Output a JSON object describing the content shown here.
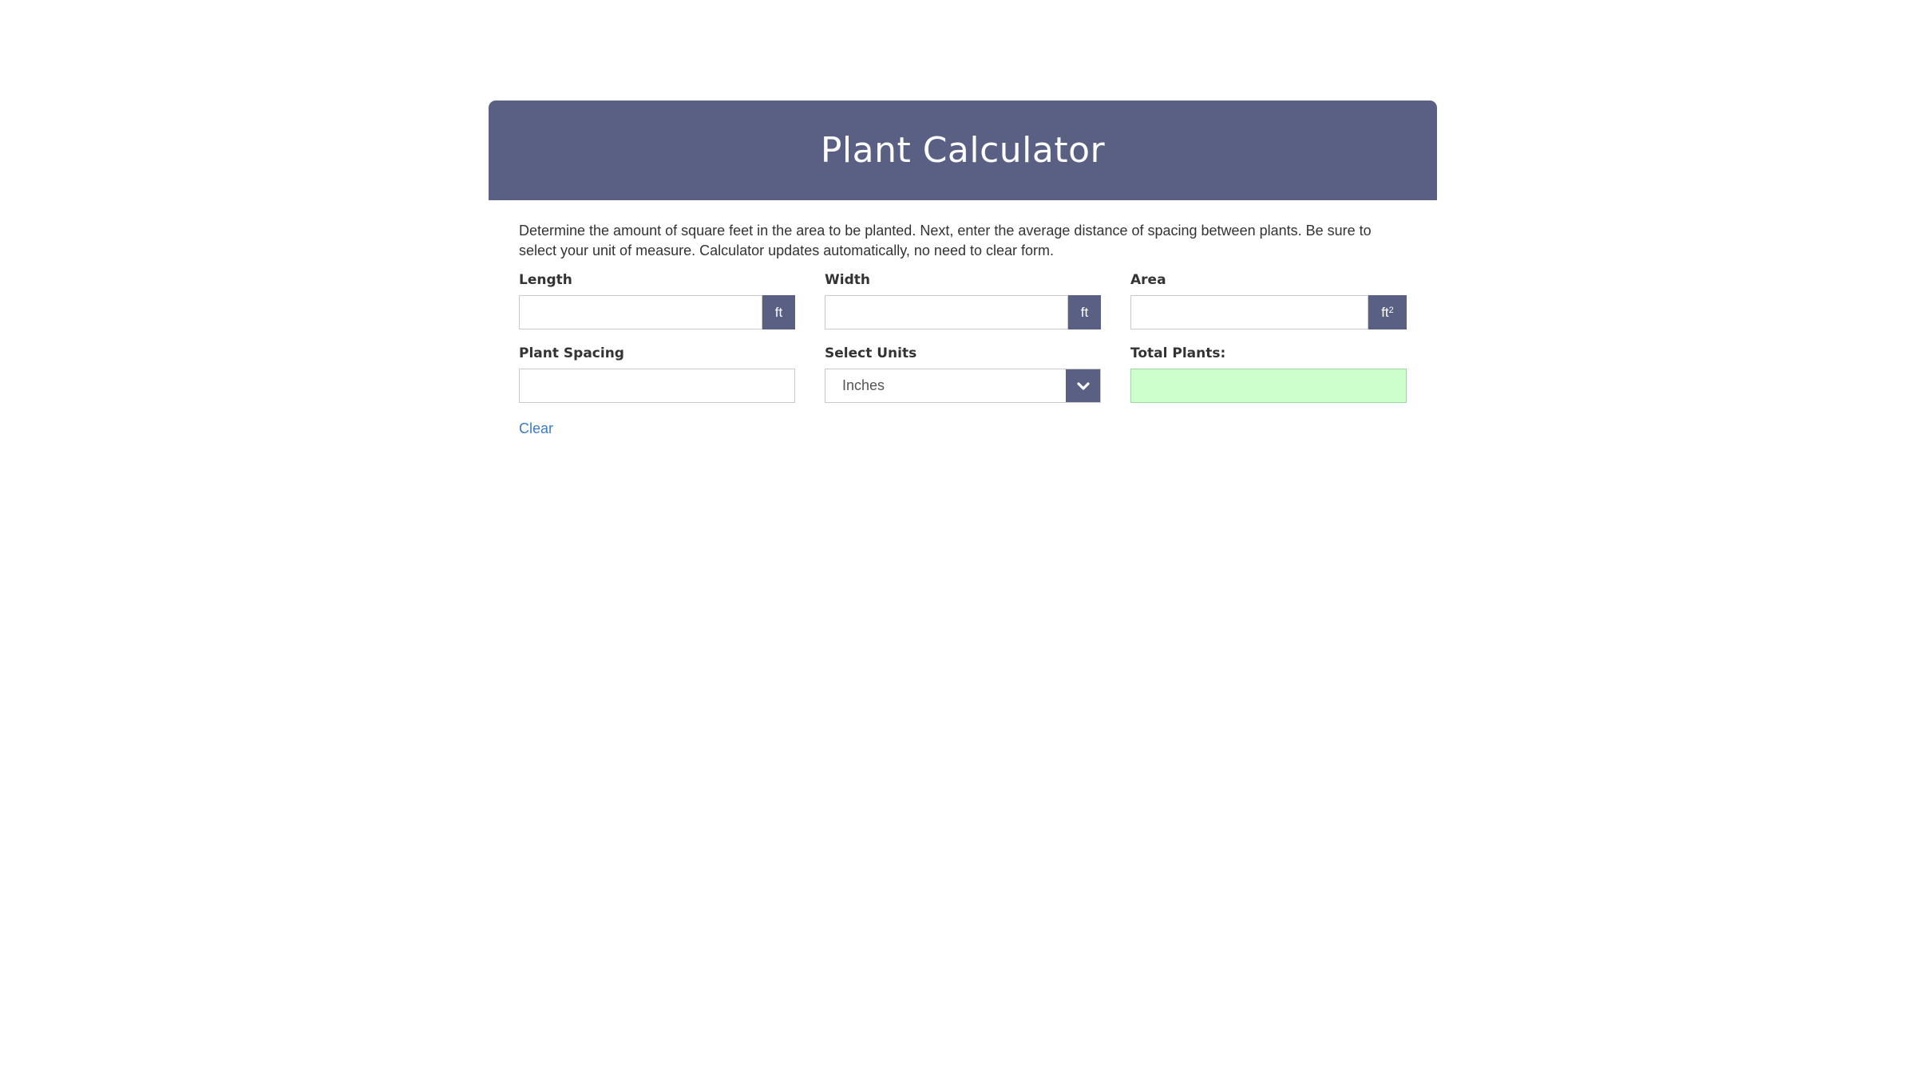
{
  "header": {
    "title": "Plant Calculator",
    "background_color": "#5a5f84"
  },
  "intro_text": "Determine the amount of square feet in the area to be planted. Next, enter the average distance of spacing between plants. Be sure to select your unit of measure. Calculator updates automatically, no need to clear form.",
  "fields": {
    "length": {
      "label": "Length",
      "value": "",
      "unit": "ft"
    },
    "width": {
      "label": "Width",
      "value": "",
      "unit": "ft"
    },
    "area": {
      "label": "Area",
      "value": "",
      "unit": "ft",
      "unit_superscript": "2"
    },
    "plant_spacing": {
      "label": "Plant Spacing",
      "value": ""
    },
    "select_units": {
      "label": "Select Units",
      "selected": "Inches",
      "icon": "chevron-down-icon"
    },
    "total_plants": {
      "label": "Total Plants:",
      "value": "",
      "background_color": "#ccffcc"
    }
  },
  "actions": {
    "clear_label": "Clear",
    "link_color": "#3b7bbf"
  }
}
